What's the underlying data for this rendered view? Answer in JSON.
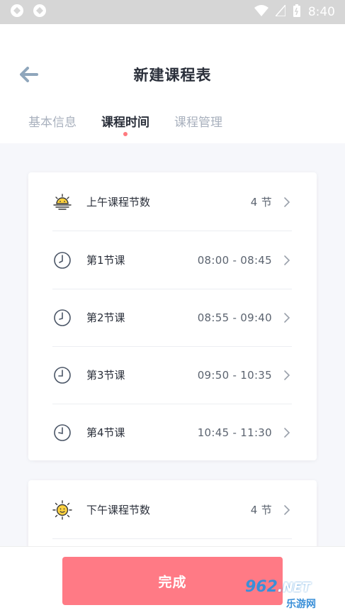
{
  "status_bar": {
    "time": "8:40",
    "icons": [
      "app-icon",
      "app-icon",
      "wifi-icon",
      "no-signal-icon",
      "battery-icon"
    ]
  },
  "header": {
    "title": "新建课程表",
    "back_icon": "arrow-left-icon",
    "tabs": [
      {
        "label": "基本信息",
        "active": false
      },
      {
        "label": "课程时间",
        "active": true
      },
      {
        "label": "课程管理",
        "active": false
      }
    ]
  },
  "morning": {
    "summary": {
      "label": "上午课程节数",
      "value": "4 节",
      "icon": "sunrise-icon"
    },
    "periods": [
      {
        "label": "第1节课",
        "value": "08:00 - 08:45",
        "icon": "clock-icon"
      },
      {
        "label": "第2节课",
        "value": "08:55 - 09:40",
        "icon": "clock-icon"
      },
      {
        "label": "第3节课",
        "value": "09:50 - 10:35",
        "icon": "clock-icon"
      },
      {
        "label": "第4节课",
        "value": "10:45 - 11:30",
        "icon": "clock-icon"
      }
    ]
  },
  "afternoon": {
    "summary": {
      "label": "下午课程节数",
      "value": "4 节",
      "icon": "sun-icon"
    }
  },
  "footer": {
    "done_label": "完成"
  },
  "watermark": {
    "top": "962",
    "net": ".NET",
    "bottom": "乐游网"
  },
  "colors": {
    "accent": "#ff7a85",
    "tab_indicator": "#ff7a7f",
    "back_arrow": "#8fa6bc",
    "icon_yellow": "#ffd23f",
    "clock_stroke": "#4a5566"
  }
}
